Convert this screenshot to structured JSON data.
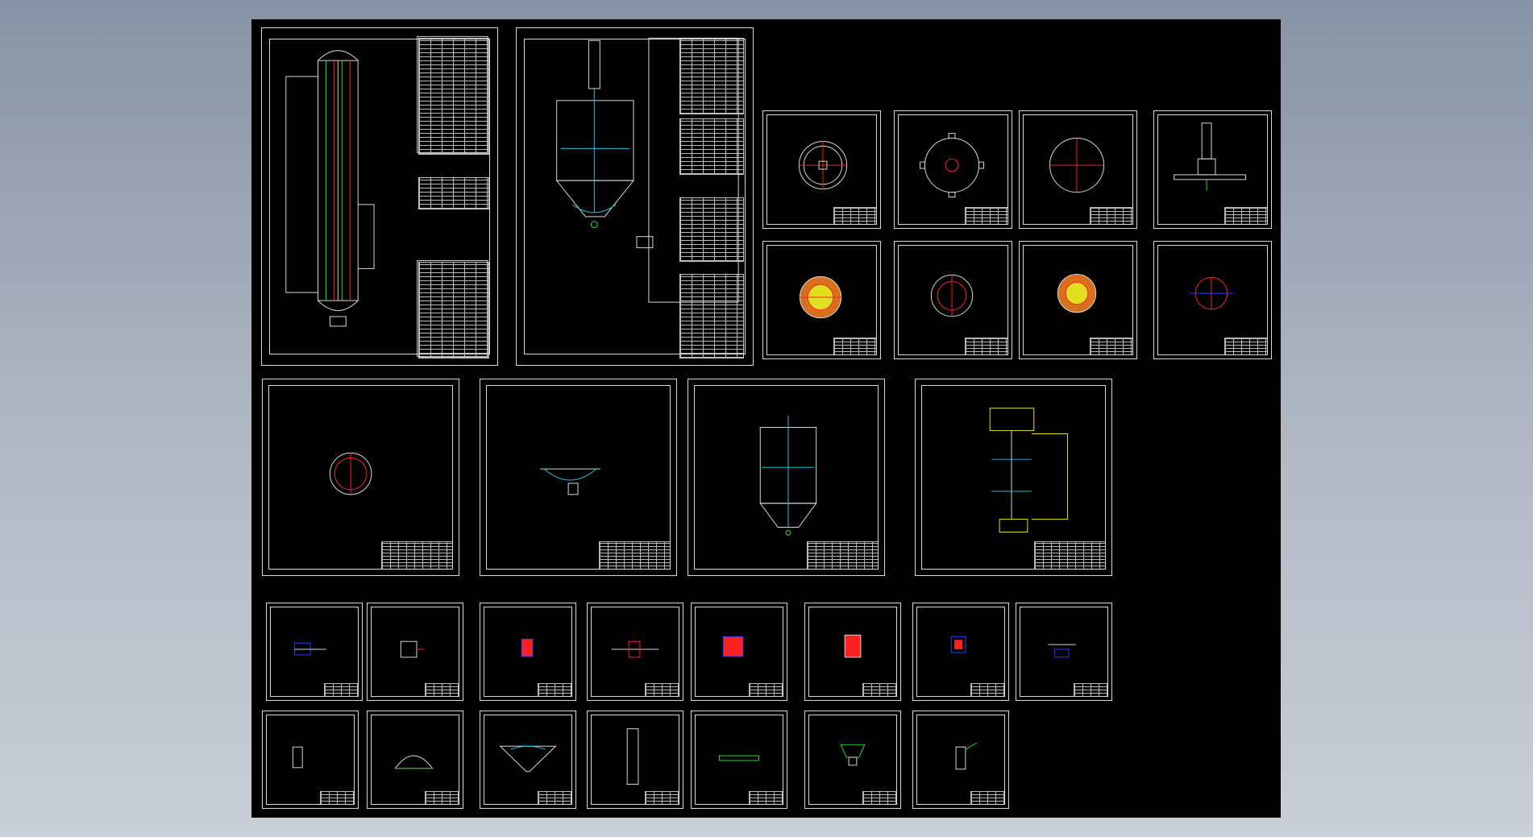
{
  "viewer": {
    "background_gradient": [
      "#8793a4",
      "#c9ced7"
    ],
    "canvas_color": "#000000"
  },
  "colors": {
    "line": "#d8d8d8",
    "red": "#ff2020",
    "green": "#20e020",
    "cyan": "#20c0e0",
    "yellow": "#e0e020",
    "blue": "#2040ff",
    "magenta": "#e040e0"
  },
  "sheets": [
    {
      "id": "assembly-tall-vessel",
      "kind": "tall-vessel"
    },
    {
      "id": "assembly-reactor",
      "kind": "reactor"
    },
    {
      "id": "flange-top-1",
      "kind": "ring-cross"
    },
    {
      "id": "flange-top-2",
      "kind": "ring-lugs"
    },
    {
      "id": "flange-top-3",
      "kind": "ring-plain"
    },
    {
      "id": "agitator-drive",
      "kind": "drive"
    },
    {
      "id": "section-1",
      "kind": "ring-filled"
    },
    {
      "id": "section-2",
      "kind": "ring-filled"
    },
    {
      "id": "section-3",
      "kind": "ring-filled"
    },
    {
      "id": "section-4",
      "kind": "ring-thin"
    },
    {
      "id": "section-view",
      "kind": "ring-filled"
    },
    {
      "id": "bottom-head",
      "kind": "head"
    },
    {
      "id": "reactor-body",
      "kind": "reactor-small"
    },
    {
      "id": "agitator-shaft",
      "kind": "shaft"
    },
    {
      "id": "detail-1",
      "kind": "detail"
    },
    {
      "id": "detail-2",
      "kind": "detail"
    },
    {
      "id": "detail-3",
      "kind": "detail"
    },
    {
      "id": "detail-4",
      "kind": "detail"
    },
    {
      "id": "detail-5",
      "kind": "detail"
    },
    {
      "id": "detail-6",
      "kind": "detail"
    },
    {
      "id": "detail-7",
      "kind": "detail"
    },
    {
      "id": "detail-8",
      "kind": "detail"
    },
    {
      "id": "part-1",
      "kind": "part"
    },
    {
      "id": "part-2",
      "kind": "dome"
    },
    {
      "id": "part-3",
      "kind": "cone"
    },
    {
      "id": "part-4",
      "kind": "part-tall"
    },
    {
      "id": "part-5",
      "kind": "bar"
    },
    {
      "id": "part-6",
      "kind": "cup"
    },
    {
      "id": "part-7",
      "kind": "part"
    }
  ]
}
